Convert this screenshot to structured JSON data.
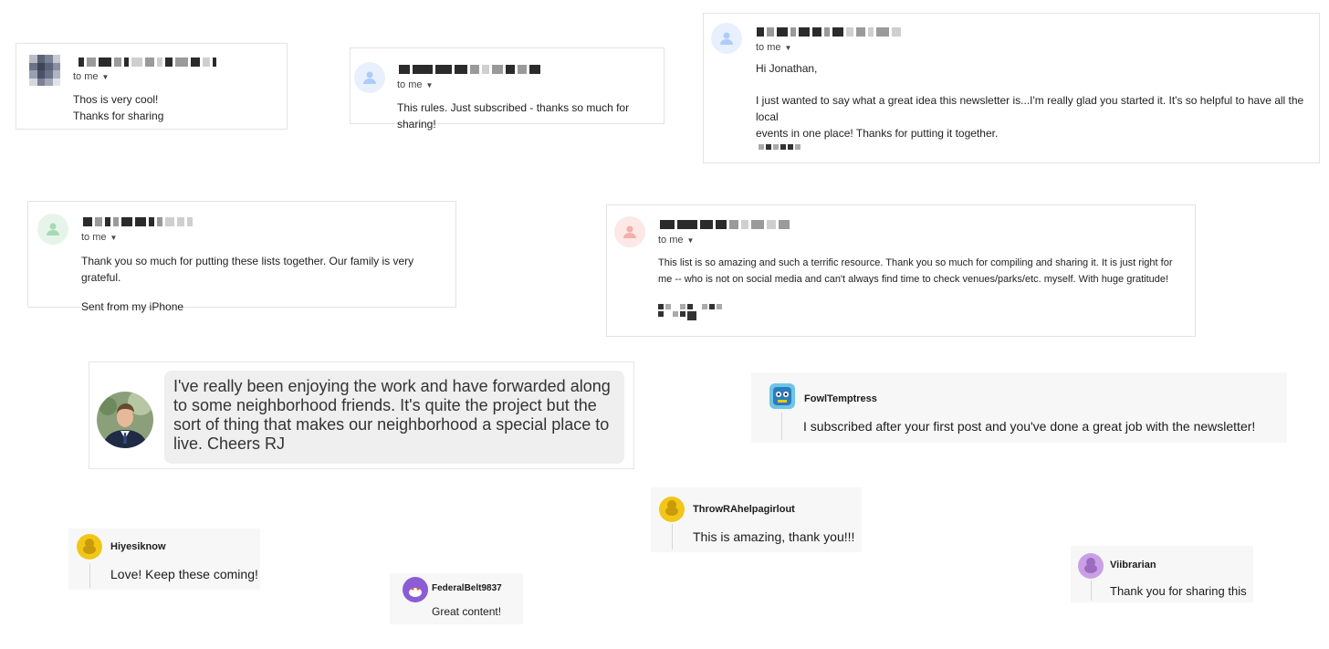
{
  "emails": [
    {
      "id": "e1",
      "to": "to me",
      "lines": [
        "Thos is very cool!",
        "Thanks for sharing"
      ]
    },
    {
      "id": "e2",
      "to": "to me",
      "lines": [
        "This rules. Just subscribed - thanks so much for sharing!"
      ]
    },
    {
      "id": "e3",
      "to": "to me",
      "greeting": "Hi Jonathan,",
      "lines": [
        "I just wanted to say what a great idea this newsletter is...I'm really glad you started it. It's so helpful to have all the local",
        "events in one place! Thanks for putting it together."
      ]
    },
    {
      "id": "e4",
      "to": "to me",
      "lines": [
        "Thank you so much for putting these lists together. Our family is very grateful."
      ],
      "footer": "Sent from my iPhone"
    },
    {
      "id": "e5",
      "to": "to me",
      "lines": [
        "This list is so amazing and such a terrific resource.  Thank you so much for compiling and sharing it.  It is just right for",
        "me -- who is not on social media and can't always find time to check venues/parks/etc. myself.  With huge gratitude!"
      ]
    }
  ],
  "message_bubble": {
    "lines": [
      "I've really been enjoying the work and have forwarded along",
      "to some neighborhood friends. It's quite the project but the",
      "sort of thing that makes our neighborhood a special place to",
      "live. Cheers RJ"
    ]
  },
  "reddit_comments": [
    {
      "id": "r1",
      "username": "FowlTemptress",
      "text": "I subscribed after your first post and you've done a great job with the newsletter!"
    },
    {
      "id": "r2",
      "username": "ThrowRAhelpagirlout",
      "text": "This is amazing, thank you!!!"
    },
    {
      "id": "r3",
      "username": "Hiyesiknow",
      "text": "Love! Keep these coming!"
    },
    {
      "id": "r4",
      "username": "FederalBelt9837",
      "text": "Great content!"
    },
    {
      "id": "r5",
      "username": "Viibrarian",
      "text": "Thank you for sharing this"
    }
  ],
  "colors": {
    "avatar_blue": "#aecbfa",
    "avatar_green": "#a8dab5",
    "avatar_red": "#f6aea9",
    "reddit_yellow": "#f2c617",
    "reddit_purple": "#8a5dd6",
    "reddit_lilac": "#c9a0e6"
  },
  "icons": [
    "person-icon",
    "caret-down-icon",
    "reddit-snoo-icon",
    "profile-photo"
  ]
}
